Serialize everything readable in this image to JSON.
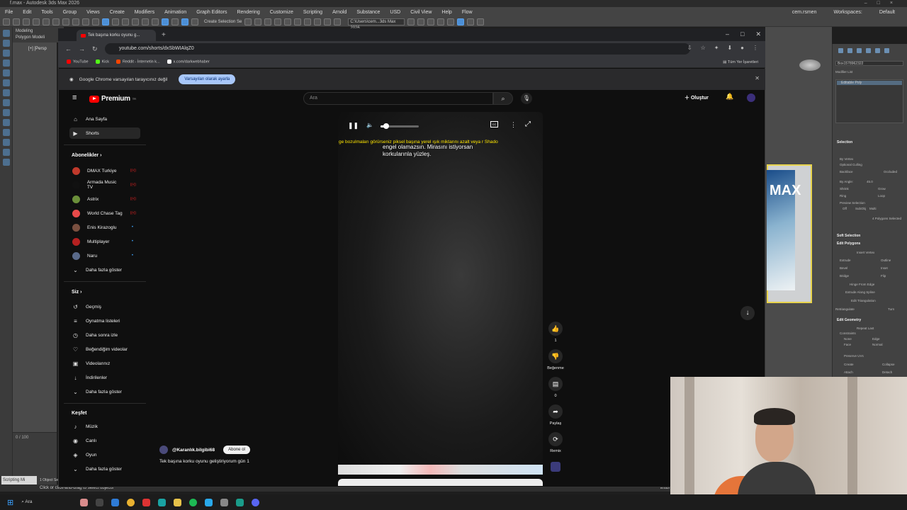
{
  "max": {
    "title": "f.max - Autodesk 3ds Max 2026",
    "menu": [
      "File",
      "Edit",
      "Tools",
      "Group",
      "Views",
      "Create",
      "Modifiers",
      "Animation",
      "Graph Editors",
      "Rendering",
      "Customize",
      "Scripting",
      "Arnold",
      "Substance",
      "USD",
      "Civil View",
      "Help",
      "Flow"
    ],
    "user": "cem.rsmen",
    "workspace_label": "Workspaces:",
    "workspace": "Default",
    "selection_set": "Create Selection Se",
    "path": "C:\\Users\\cem...3ds Max 2026",
    "tabs_text": "Modeling",
    "tabs_text2": "Polygon Modeli",
    "viewport_label": "[+] [Persp",
    "time_slider": "0 / 100",
    "object_selected": "1 Object Sele",
    "status_hint": "Click or click-and-drag to select objects",
    "script_label": "Scripting Mi",
    "enable_label": "Enabl",
    "cmd": {
      "object_name": "Box1578962322",
      "modifier_list": "Modifier List",
      "stack_item": "Editable Poly",
      "selection_head": "Selection",
      "by_vertex": "By Vertex",
      "ignore_backfacing": "Optional Culling",
      "backface": "Backface",
      "occluded": "Occluded",
      "by_angle": "By Angle:",
      "angle_val": "45.0",
      "shrink": "Shrink",
      "grow": "Grow",
      "ring": "Ring",
      "loop": "Loop",
      "preview_selection": "Preview Selection",
      "preview_opts": [
        "Off",
        "SubObj",
        "Multi"
      ],
      "polygons_selected": "4 Polygons Selected",
      "soft_selection": "Soft Selection",
      "edit_polygons": "Edit Polygons",
      "insert_vertex": "Insert Vertex",
      "ep_buttons": [
        "Extrude",
        "Outline",
        "Bevel",
        "Inset",
        "Bridge",
        "Flip"
      ],
      "hinge": "Hinge From Edge",
      "extrude_spline": "Extrude Along Spline",
      "edit_tri": "Edit Triangulation",
      "retriangulate": "Retriangulate",
      "turn": "Turn",
      "edit_geometry": "Edit Geometry",
      "repeat_last": "Repeat Last",
      "constraints": "Constraints",
      "constraint_opts": [
        "None",
        "Edge",
        "Face",
        "Normal"
      ],
      "preserve_uvs": "Preserve UVs",
      "create": "Create",
      "collapse": "Collapse",
      "attach": "Attach",
      "detach": "Detach"
    },
    "poster_text": "MAX"
  },
  "chrome": {
    "tab_title": "Tek başına korku oyunu g...",
    "url": "youtube.com/shorts/dxSbWIAlqZ0",
    "bookmarks": [
      {
        "label": "YouTube",
        "color": "#ff0000"
      },
      {
        "label": "Kick",
        "color": "#53fc18"
      },
      {
        "label": "Reddit - İnternetin k...",
        "color": "#ff4500"
      },
      {
        "label": "x.com/darkwebhaber",
        "color": "#ffffff"
      }
    ],
    "all_bookmarks": "Tüm Yer İşaretleri",
    "infobar_text": "Google Chrome varsayılan tarayıcınız değil",
    "infobar_button": "Varsayılan olarak ayarla"
  },
  "youtube": {
    "logo_text": "Premium",
    "logo_sup": "TR",
    "search_placeholder": "Ara",
    "create_label": "Oluştur",
    "nav": [
      {
        "icon": "⌂",
        "label": "Ana Sayfa",
        "selected": false
      },
      {
        "icon": "▶",
        "label": "Shorts",
        "selected": true
      }
    ],
    "subs_heading": "Abonelikler",
    "subs": [
      {
        "label": "DMAX Turkiye",
        "color": "#c0392b",
        "badge": "live"
      },
      {
        "label": "Armada Music TV",
        "color": "#111111",
        "badge": "live"
      },
      {
        "label": "Astrix",
        "color": "#6b8f3a",
        "badge": "live"
      },
      {
        "label": "World Chase Tag",
        "color": "#e84a4a",
        "badge": "live"
      },
      {
        "label": "Enis Kirazoglu",
        "color": "#7a5040",
        "badge": "dot"
      },
      {
        "label": "Multiplayer",
        "color": "#b52020",
        "badge": "dot"
      },
      {
        "label": "Naru",
        "color": "#5a6a8a",
        "badge": "dot"
      }
    ],
    "subs_more": "Daha fazla göster",
    "you_heading": "Siz",
    "you_items": [
      {
        "icon": "↺",
        "label": "Geçmiş"
      },
      {
        "icon": "≡",
        "label": "Oynatma listeleri"
      },
      {
        "icon": "◷",
        "label": "Daha sonra izle"
      },
      {
        "icon": "♡",
        "label": "Beğendiğim videolar"
      },
      {
        "icon": "▣",
        "label": "Videolarınız"
      },
      {
        "icon": "↓",
        "label": "İndirilenler"
      }
    ],
    "you_more": "Daha fazla göster",
    "explore_heading": "Keşfet",
    "explore_items": [
      {
        "icon": "♪",
        "label": "Müzik"
      },
      {
        "icon": "◉",
        "label": "Canlı"
      },
      {
        "icon": "◈",
        "label": "Oyun"
      }
    ],
    "explore_more": "Daha fazla göster",
    "player": {
      "volume": 0.15,
      "subtitle_burned": "ge bozulmaları görürseniz piksel başına yerel ışık miktarını azalt veya r Shado",
      "subtitle_main": "engel olamazsın. Mirasını istiyorsan korkularınla yüzleş."
    },
    "channel": "@Karanlık.bilgibi68",
    "subscribe": "Abone ol",
    "video_title": "Tek başına korku oyunu geliştiriyorum gün 1",
    "actions": {
      "likes": "1",
      "dislike_label": "Beğenme",
      "comments": "0",
      "share_label": "Paylaş",
      "remix_label": "Remix"
    }
  },
  "taskbar": {
    "search": "Ara"
  }
}
